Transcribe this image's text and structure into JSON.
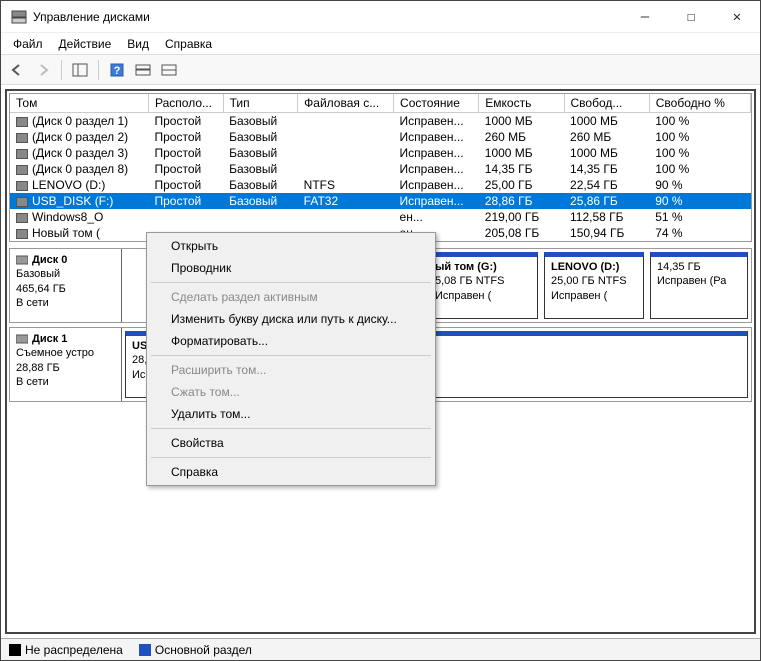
{
  "window": {
    "title": "Управление дисками"
  },
  "menu": {
    "file": "Файл",
    "action": "Действие",
    "view": "Вид",
    "help": "Справка"
  },
  "columns": {
    "vol": "Том",
    "layout": "Располо...",
    "type": "Тип",
    "fs": "Файловая с...",
    "status": "Состояние",
    "capacity": "Емкость",
    "free": "Свобод...",
    "freepct": "Свободно %"
  },
  "volumes": [
    {
      "name": "(Диск 0 раздел 1)",
      "layout": "Простой",
      "type": "Базовый",
      "fs": "",
      "status": "Исправен...",
      "cap": "1000 МБ",
      "free": "1000 МБ",
      "pct": "100 %"
    },
    {
      "name": "(Диск 0 раздел 2)",
      "layout": "Простой",
      "type": "Базовый",
      "fs": "",
      "status": "Исправен...",
      "cap": "260 МБ",
      "free": "260 МБ",
      "pct": "100 %"
    },
    {
      "name": "(Диск 0 раздел 3)",
      "layout": "Простой",
      "type": "Базовый",
      "fs": "",
      "status": "Исправен...",
      "cap": "1000 МБ",
      "free": "1000 МБ",
      "pct": "100 %"
    },
    {
      "name": "(Диск 0 раздел 8)",
      "layout": "Простой",
      "type": "Базовый",
      "fs": "",
      "status": "Исправен...",
      "cap": "14,35 ГБ",
      "free": "14,35 ГБ",
      "pct": "100 %"
    },
    {
      "name": "LENOVO (D:)",
      "layout": "Простой",
      "type": "Базовый",
      "fs": "NTFS",
      "status": "Исправен...",
      "cap": "25,00 ГБ",
      "free": "22,54 ГБ",
      "pct": "90 %"
    },
    {
      "name": "USB_DISK (F:)",
      "layout": "Простой",
      "type": "Базовый",
      "fs": "FAT32",
      "status": "Исправен...",
      "cap": "28,86 ГБ",
      "free": "25,86 ГБ",
      "pct": "90 %",
      "selected": true
    },
    {
      "name": "Windows8_O",
      "layout": "",
      "type": "",
      "fs": "",
      "status": "ен...",
      "cap": "219,00 ГБ",
      "free": "112,58 ГБ",
      "pct": "51 %"
    },
    {
      "name": "Новый том (",
      "layout": "",
      "type": "",
      "fs": "",
      "status": "ен...",
      "cap": "205,08 ГБ",
      "free": "150,94 ГБ",
      "pct": "74 %"
    }
  ],
  "context": {
    "open": "Открыть",
    "explorer": "Проводник",
    "active": "Сделать раздел активным",
    "change_letter": "Изменить букву диска или путь к диску...",
    "format": "Форматировать...",
    "extend": "Расширить том...",
    "shrink": "Сжать том...",
    "delete": "Удалить том...",
    "props": "Свойства",
    "help": "Справка"
  },
  "disk0": {
    "name": "Диск 0",
    "type": "Базовый",
    "size": "465,64 ГБ",
    "state": "В сети",
    "p1": {
      "name": "ый том (G:)",
      "line2": "5,08 ГБ NTFS",
      "line3": "Исправен ("
    },
    "p2": {
      "name": "LENOVO  (D:)",
      "line2": "25,00 ГБ NTFS",
      "line3": "Исправен ("
    },
    "p3": {
      "name": "",
      "line2": "14,35 ГБ",
      "line3": "Исправен (Ра"
    }
  },
  "disk1": {
    "name": "Диск 1",
    "type": "Съемное устро",
    "size": "28,88 ГБ",
    "state": "В сети",
    "p1": {
      "name": "USB_DISK  (F:)",
      "line2": "28,88 ГБ FAT32",
      "line3": "Исправен (Основной раздел)"
    }
  },
  "legend": {
    "unalloc": "Не распределена",
    "primary": "Основной раздел"
  }
}
